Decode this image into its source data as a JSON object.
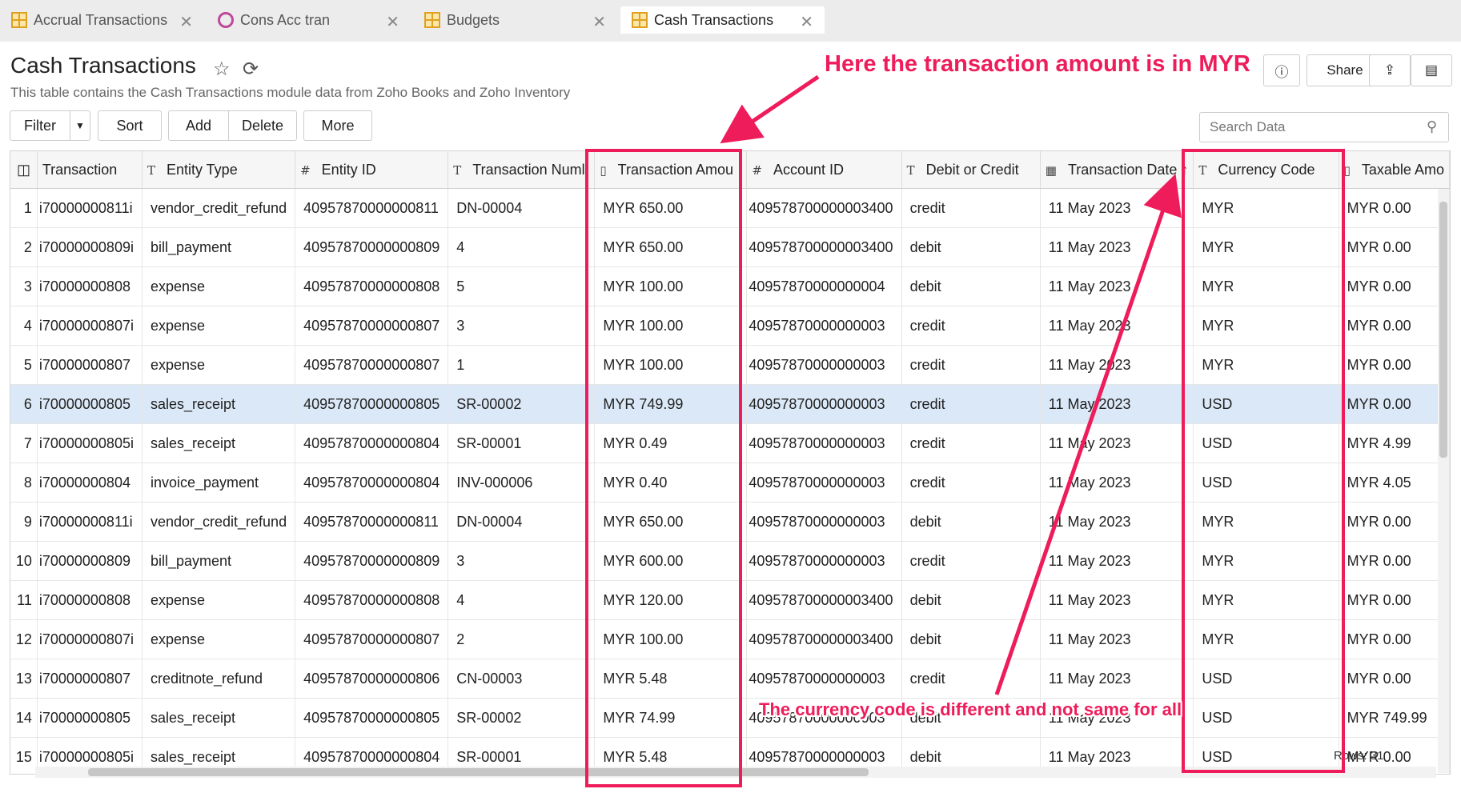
{
  "tabs": [
    {
      "label": "Accrual Transactions",
      "icon": "table-icon",
      "active": false
    },
    {
      "label": "Cons Acc tran",
      "icon": "query-icon",
      "active": false
    },
    {
      "label": "Budgets",
      "icon": "table-icon",
      "active": false
    },
    {
      "label": "Cash Transactions",
      "icon": "table-icon",
      "active": true
    }
  ],
  "header": {
    "title": "Cash Transactions",
    "subtitle": "This table contains the Cash Transactions module data from Zoho Books and Zoho Inventory",
    "share_label": "Share"
  },
  "toolbar": {
    "filter_label": "Filter",
    "sort_label": "Sort",
    "add_label": "Add",
    "delete_label": "Delete",
    "more_label": "More"
  },
  "search": {
    "placeholder": "Search Data"
  },
  "table": {
    "columns": [
      {
        "label": "Transaction",
        "type": "T"
      },
      {
        "label": "Entity Type",
        "type": "T"
      },
      {
        "label": "Entity ID",
        "type": "#"
      },
      {
        "label": "Transaction Numl",
        "type": "T"
      },
      {
        "label": "Transaction Amou",
        "type": "$"
      },
      {
        "label": "Account ID",
        "type": "#"
      },
      {
        "label": "Debit or Credit",
        "type": "T"
      },
      {
        "label": "Transaction Date",
        "type": "date"
      },
      {
        "label": "Currency Code",
        "type": "T"
      },
      {
        "label": "Taxable Amo",
        "type": "$"
      }
    ],
    "rows": [
      [
        "1",
        "i70000000811i",
        "vendor_credit_refund",
        "40957870000000811",
        "DN-00004",
        "MYR 650.00",
        "409578700000003400",
        "credit",
        "11 May 2023",
        "MYR",
        "MYR 0.00"
      ],
      [
        "2",
        "i70000000809i",
        "bill_payment",
        "40957870000000809",
        "4",
        "MYR 650.00",
        "409578700000003400",
        "debit",
        "11 May 2023",
        "MYR",
        "MYR 0.00"
      ],
      [
        "3",
        "i70000000808",
        "expense",
        "40957870000000808",
        "5",
        "MYR 100.00",
        "40957870000000004",
        "debit",
        "11 May 2023",
        "MYR",
        "MYR 0.00"
      ],
      [
        "4",
        "i70000000807i",
        "expense",
        "40957870000000807",
        "3",
        "MYR 100.00",
        "40957870000000003",
        "credit",
        "11 May 2023",
        "MYR",
        "MYR 0.00"
      ],
      [
        "5",
        "i70000000807",
        "expense",
        "40957870000000807",
        "1",
        "MYR 100.00",
        "40957870000000003",
        "credit",
        "11 May 2023",
        "MYR",
        "MYR 0.00"
      ],
      [
        "6",
        "i70000000805",
        "sales_receipt",
        "40957870000000805",
        "SR-00002",
        "MYR 749.99",
        "40957870000000003",
        "credit",
        "11 May 2023",
        "USD",
        "MYR 0.00"
      ],
      [
        "7",
        "i70000000805i",
        "sales_receipt",
        "40957870000000804",
        "SR-00001",
        "MYR 0.49",
        "40957870000000003",
        "credit",
        "11 May 2023",
        "USD",
        "MYR 4.99"
      ],
      [
        "8",
        "i70000000804",
        "invoice_payment",
        "40957870000000804",
        "INV-000006",
        "MYR 0.40",
        "40957870000000003",
        "credit",
        "11 May 2023",
        "USD",
        "MYR 4.05"
      ],
      [
        "9",
        "i70000000811i",
        "vendor_credit_refund",
        "40957870000000811",
        "DN-00004",
        "MYR 650.00",
        "40957870000000003",
        "debit",
        "11 May 2023",
        "MYR",
        "MYR 0.00"
      ],
      [
        "10",
        "i70000000809",
        "bill_payment",
        "40957870000000809",
        "3",
        "MYR 600.00",
        "40957870000000003",
        "credit",
        "11 May 2023",
        "MYR",
        "MYR 0.00"
      ],
      [
        "11",
        "i70000000808",
        "expense",
        "40957870000000808",
        "4",
        "MYR 120.00",
        "409578700000003400",
        "debit",
        "11 May 2023",
        "MYR",
        "MYR 0.00"
      ],
      [
        "12",
        "i70000000807i",
        "expense",
        "40957870000000807",
        "2",
        "MYR 100.00",
        "409578700000003400",
        "debit",
        "11 May 2023",
        "MYR",
        "MYR 0.00"
      ],
      [
        "13",
        "i70000000807",
        "creditnote_refund",
        "40957870000000806",
        "CN-00003",
        "MYR 5.48",
        "40957870000000003",
        "credit",
        "11 May 2023",
        "USD",
        "MYR 0.00"
      ],
      [
        "14",
        "i70000000805",
        "sales_receipt",
        "40957870000000805",
        "SR-00002",
        "MYR 74.99",
        "40957870000000003",
        "debit",
        "11 May 2023",
        "USD",
        "MYR 749.99"
      ],
      [
        "15",
        "i70000000805i",
        "sales_receipt",
        "40957870000000804",
        "SR-00001",
        "MYR 5.48",
        "40957870000000003",
        "debit",
        "11 May 2023",
        "USD",
        "MYR 0.00"
      ]
    ],
    "selected_row": 6
  },
  "footer": {
    "rows_label": "Rows: 31"
  },
  "annotations": {
    "amount_note": "Here the transaction amount is in MYR",
    "currency_note": "The currency code is different and not same for all",
    "color": "#ee1c5a"
  }
}
